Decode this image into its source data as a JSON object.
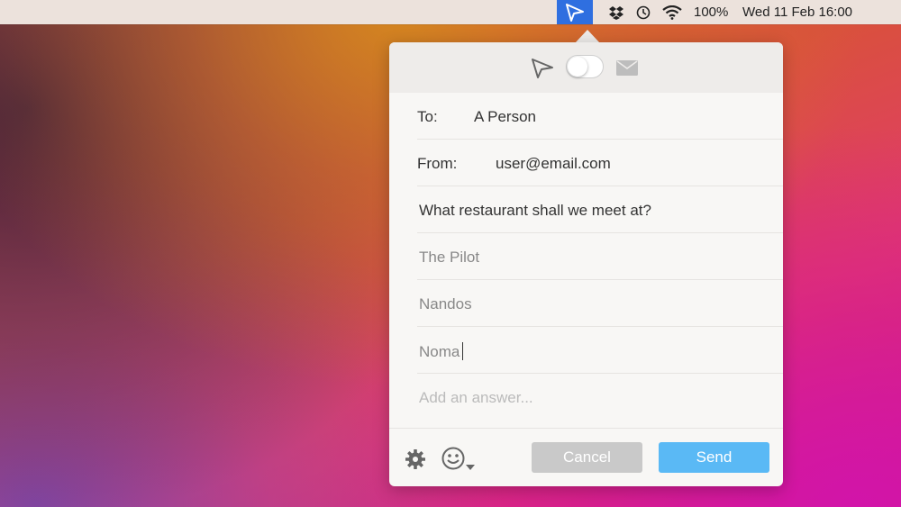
{
  "menubar": {
    "battery": "100%",
    "datetime": "Wed 11 Feb 16:00",
    "icons": [
      "paper-plane-icon",
      "dropbox-icon",
      "clock-icon",
      "wifi-icon"
    ],
    "app_highlight_color": "#2f6fe0"
  },
  "popover": {
    "header_icons": [
      "paper-plane-icon",
      "toggle-switch",
      "envelope-icon"
    ],
    "to_label": "To:",
    "to_value": "A Person",
    "from_label": "From:",
    "from_value": "user@email.com",
    "question": "What restaurant shall we meet at?",
    "answers": [
      "The Pilot",
      "Nandos",
      "Noma"
    ],
    "add_answer_placeholder": "Add an answer...",
    "footer_icons": [
      "gear-icon",
      "smiley-icon"
    ],
    "cancel_label": "Cancel",
    "send_label": "Send",
    "send_color": "#5ab9f5",
    "cancel_color": "#c9c9c9"
  }
}
